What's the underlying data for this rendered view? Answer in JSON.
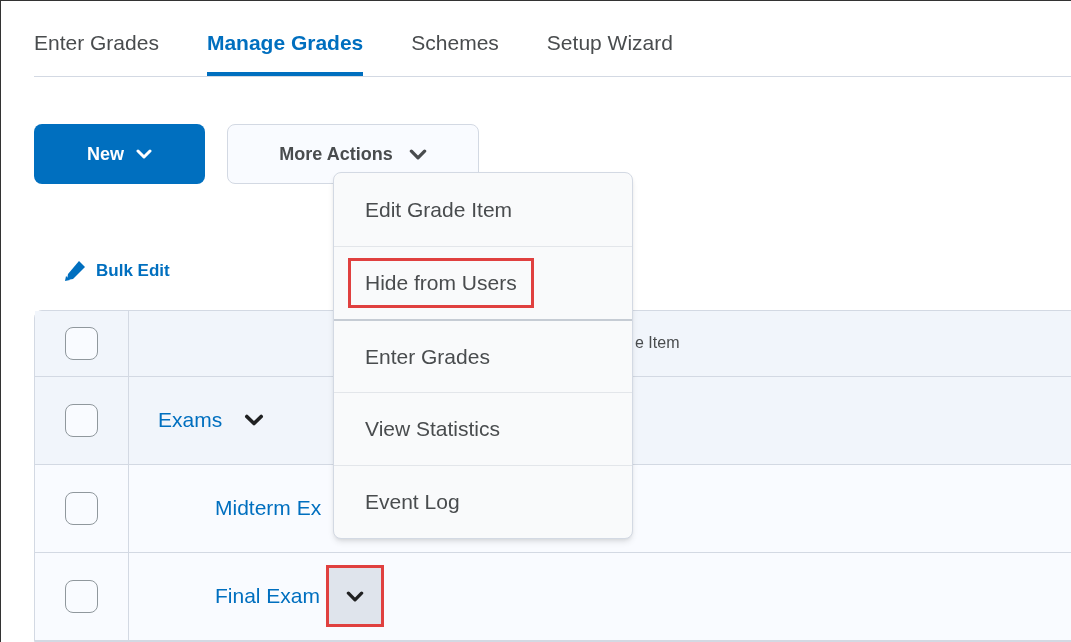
{
  "tabs": [
    {
      "label": "Enter Grades",
      "selected": false
    },
    {
      "label": "Manage Grades",
      "selected": true
    },
    {
      "label": "Schemes",
      "selected": false
    },
    {
      "label": "Setup Wizard",
      "selected": false
    }
  ],
  "toolbar": {
    "new_button": "New",
    "more_actions_button": "More Actions"
  },
  "bulk_edit": "Bulk Edit",
  "table": {
    "header": {
      "checked": false,
      "column_2": "e Item"
    },
    "rows": [
      {
        "label": "Exams",
        "checked": false,
        "children": [
          {
            "label": "Midterm Ex",
            "checked": false
          },
          {
            "label": "Final Exam",
            "checked": false,
            "dropdown_button": {
              "highlighted": true
            }
          }
        ]
      }
    ]
  },
  "menu": {
    "items": [
      {
        "label": "Edit Grade Item",
        "highlighted": false
      },
      {
        "label": "Hide from Users",
        "highlighted": true
      },
      {
        "label": "Enter Grades",
        "highlighted": false
      },
      {
        "label": "View Statistics",
        "highlighted": false
      },
      {
        "label": "Event Log",
        "highlighted": false
      }
    ]
  }
}
